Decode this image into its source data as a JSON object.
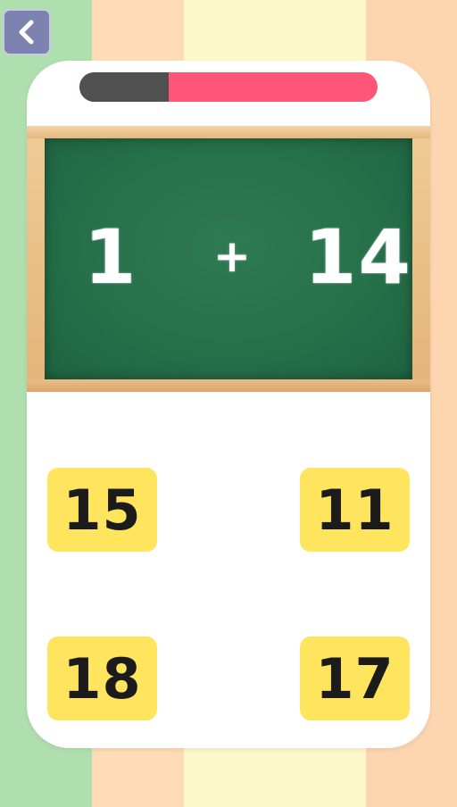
{
  "game": {
    "progress_fraction": 0.3,
    "equation": {
      "operand_a": "1",
      "operator": "+",
      "operand_b": "14"
    },
    "answers": [
      "15",
      "11",
      "18",
      "17"
    ]
  },
  "icons": {
    "back": "chevron-left-icon"
  },
  "colors": {
    "card": "#ffffff",
    "board": "#26704a",
    "progress_track": "#ff5577",
    "progress_fill": "#505050",
    "answer_bg": "#ffe45e",
    "back_button": "#7d83b0"
  }
}
